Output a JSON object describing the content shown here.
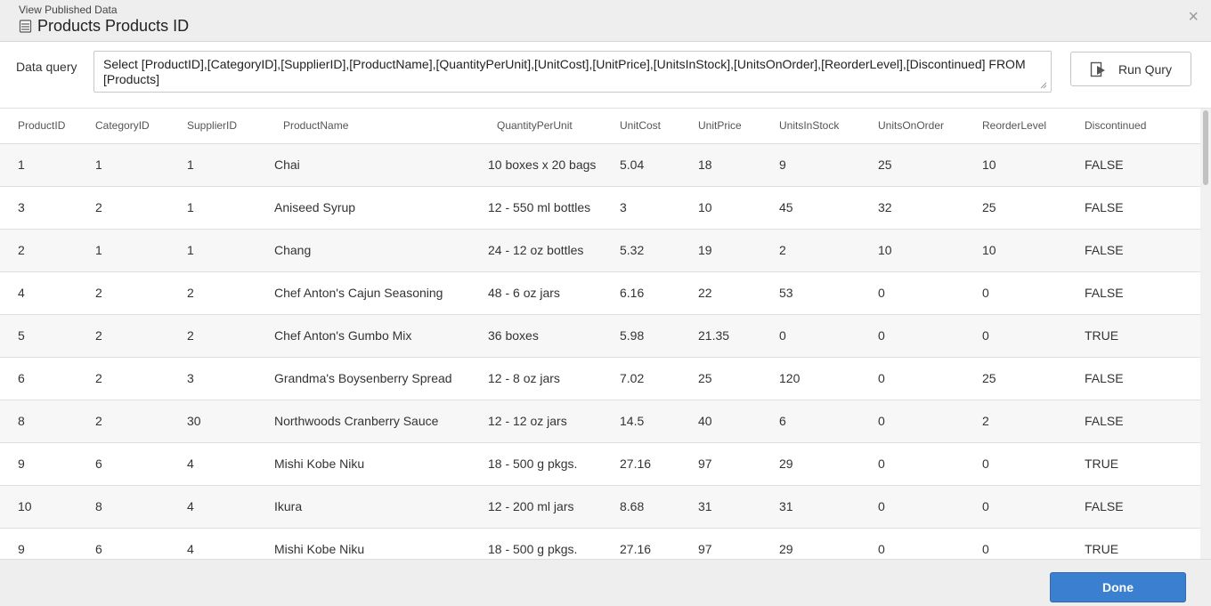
{
  "dialog": {
    "subtitle": "View Published Data",
    "title": "Products Products ID",
    "close_glyph": "×"
  },
  "query": {
    "label": "Data query",
    "text": "Select [ProductID],[CategoryID],[SupplierID],[ProductName],[QuantityPerUnit],[UnitCost],[UnitPrice],[UnitsInStock],[UnitsOnOrder],[ReorderLevel],[Discontinued] FROM [Products]",
    "run_label": "Run Qury"
  },
  "table": {
    "columns": [
      "ProductID",
      "CategoryID",
      "SupplierID",
      "ProductName",
      "QuantityPerUnit",
      "UnitCost",
      "UnitPrice",
      "UnitsInStock",
      "UnitsOnOrder",
      "ReorderLevel",
      "Discontinued"
    ],
    "rows": [
      [
        "1",
        "1",
        "1",
        "Chai",
        "10 boxes x 20 bags",
        "5.04",
        "18",
        "9",
        "25",
        "10",
        "FALSE"
      ],
      [
        "3",
        "2",
        "1",
        "Aniseed Syrup",
        "12 - 550 ml bottles",
        "3",
        "10",
        "45",
        "32",
        "25",
        "FALSE"
      ],
      [
        "2",
        "1",
        "1",
        "Chang",
        "24 - 12 oz bottles",
        "5.32",
        "19",
        "2",
        "10",
        "10",
        "FALSE"
      ],
      [
        "4",
        "2",
        "2",
        "Chef Anton's Cajun Seasoning",
        "48 - 6 oz jars",
        "6.16",
        "22",
        "53",
        "0",
        "0",
        "FALSE"
      ],
      [
        "5",
        "2",
        "2",
        "Chef Anton's Gumbo Mix",
        "36 boxes",
        "5.98",
        "21.35",
        "0",
        "0",
        "0",
        "TRUE"
      ],
      [
        "6",
        "2",
        "3",
        "Grandma's Boysenberry Spread",
        "12 - 8 oz jars",
        "7.02",
        "25",
        "120",
        "0",
        "25",
        "FALSE"
      ],
      [
        "8",
        "2",
        "30",
        "Northwoods Cranberry Sauce",
        "12 - 12 oz jars",
        "14.5",
        "40",
        "6",
        "0",
        "2",
        "FALSE"
      ],
      [
        "9",
        "6",
        "4",
        "Mishi Kobe Niku",
        "18 - 500 g pkgs.",
        "27.16",
        "97",
        "29",
        "0",
        "0",
        "TRUE"
      ],
      [
        "10",
        "8",
        "4",
        "Ikura",
        "12 - 200 ml jars",
        "8.68",
        "31",
        "31",
        "0",
        "0",
        "FALSE"
      ],
      [
        "9",
        "6",
        "4",
        "Mishi Kobe Niku",
        "18 - 500 g pkgs.",
        "27.16",
        "97",
        "29",
        "0",
        "0",
        "TRUE"
      ]
    ]
  },
  "footer": {
    "done_label": "Done"
  },
  "icons": {
    "title_icon": "database-icon",
    "run_icon": "run-query-icon",
    "close_icon": "close-icon"
  },
  "colors": {
    "primary_button": "#3a7fd0",
    "header_bg": "#eeeeee",
    "row_alt_bg": "#f7f7f7"
  }
}
